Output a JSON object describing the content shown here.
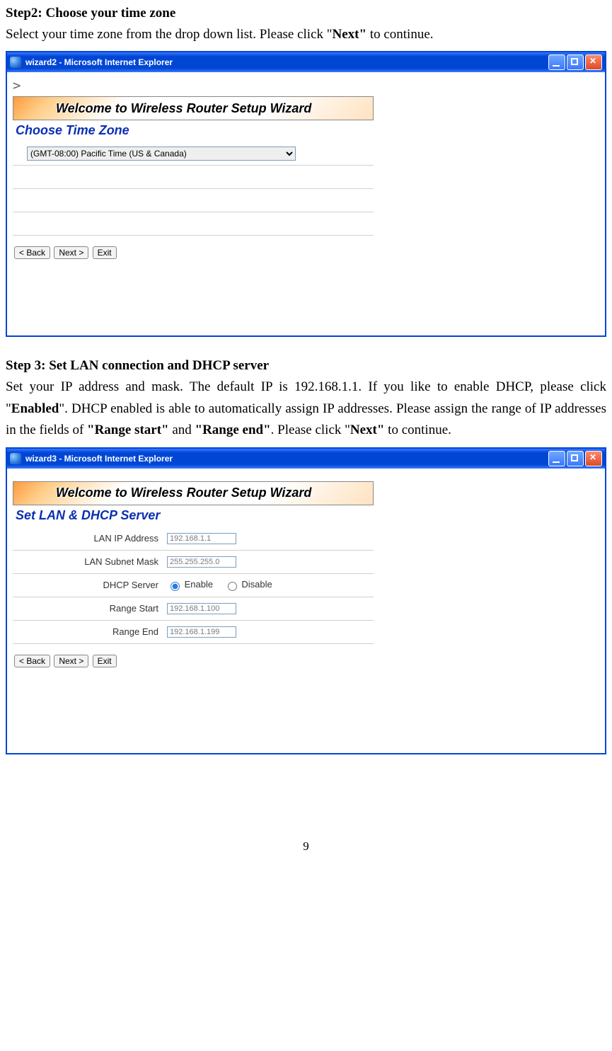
{
  "step2": {
    "heading": "Step2: Choose your time zone",
    "desc_pre": "Select your time zone from the drop down list.    Please click \"",
    "desc_bold": "Next\"",
    "desc_post": " to continue."
  },
  "step3": {
    "heading": "Step 3: Set LAN connection and DHCP server",
    "p1_a": "Set your IP address and mask.    The default IP is 192.168.1.1.    If you like to enable DHCP, please click \"",
    "p1_b_bold": "Enabled",
    "p1_c": "\".   DHCP enabled is able to automatically assign IP addresses.    Please assign the range of IP addresses in the fields of ",
    "p1_d_bold": "\"Range start\"",
    "p1_e": " and ",
    "p1_f_bold": "\"Range end\"",
    "p1_g": ".    Please click \"",
    "p1_h_bold": "Next\"",
    "p1_i": " to continue."
  },
  "win1": {
    "title": "wizard2 - Microsoft Internet Explorer",
    "banner": "Welcome to Wireless Router Setup Wizard",
    "section": "Choose Time Zone",
    "tz_value": "(GMT-08:00) Pacific Time (US & Canada)",
    "greater": ">"
  },
  "win2": {
    "title": "wizard3 - Microsoft Internet Explorer",
    "banner": "Welcome to Wireless Router Setup Wizard",
    "section": "Set LAN & DHCP Server",
    "fields": {
      "lan_ip_label": "LAN IP Address",
      "lan_ip_value": "192.168.1.1",
      "mask_label": "LAN Subnet Mask",
      "mask_value": "255.255.255.0",
      "dhcp_label": "DHCP Server",
      "enable": "Enable",
      "disable": "Disable",
      "rstart_label": "Range Start",
      "rstart_value": "192.168.1.100",
      "rend_label": "Range End",
      "rend_value": "192.168.1.199"
    }
  },
  "buttons": {
    "back": "< Back",
    "next": "Next >",
    "exit": "Exit"
  },
  "page_number": "9"
}
